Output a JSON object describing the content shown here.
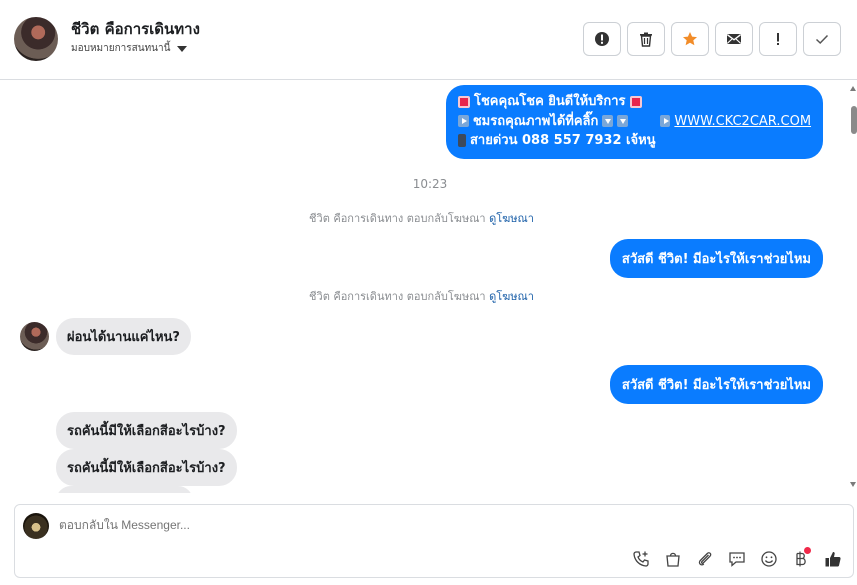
{
  "header": {
    "title": "ชีวิต คือการเดินทาง",
    "subtitle": "มอบหมายการสนทนานี้",
    "actions": [
      {
        "name": "spam-alert-button",
        "icon": "alert-circle-icon"
      },
      {
        "name": "delete-button",
        "icon": "trash-icon"
      },
      {
        "name": "star-button",
        "icon": "star-icon",
        "color": "#f28c28"
      },
      {
        "name": "mail-button",
        "icon": "envelope-icon"
      },
      {
        "name": "mark-important-button",
        "icon": "exclamation-icon"
      },
      {
        "name": "mark-done-button",
        "icon": "check-icon"
      }
    ]
  },
  "messages": {
    "promo": {
      "line1": "โชคคุณโชค ยินดีให้บริการ",
      "line2": "ชมรถคุณภาพได้ที่คลิ๊ก",
      "link": "WWW.CKC2CAR.COM",
      "line3": "สายด่วน 088 557 7932 เจ้หนู"
    },
    "time": "10:23",
    "sys1": {
      "text": "ชีวิต คือการเดินทาง ตอบกลับโฆษณา",
      "link": "ดูโฆษณา"
    },
    "out1": "สวัสดี ชีวิต! มีอะไรให้เราช่วยไหม",
    "sys2": {
      "text": "ชีวิต คือการเดินทาง ตอบกลับโฆษณา",
      "link": "ดูโฆษณา"
    },
    "in1": "ผ่อนได้นานแค่ไหน?",
    "out2": "สวัสดี ชีวิต! มีอะไรให้เราช่วยไหม",
    "in2": "รถคันนี้มีให้เลือกสีอะไรบ้าง?",
    "in3": "รถคันนี้มีให้เลือกสีอะไรบ้าง?"
  },
  "composer": {
    "placeholder": "ตอบกลับใน Messenger...",
    "tools": [
      "phone-add-icon",
      "shopping-bag-icon",
      "paperclip-icon",
      "chat-bubble-icon",
      "smile-icon",
      "baht-icon",
      "thumbs-up-icon"
    ]
  },
  "colors": {
    "accent": "#0a7cff",
    "incoming": "#e9e9eb",
    "star": "#f28c28"
  }
}
